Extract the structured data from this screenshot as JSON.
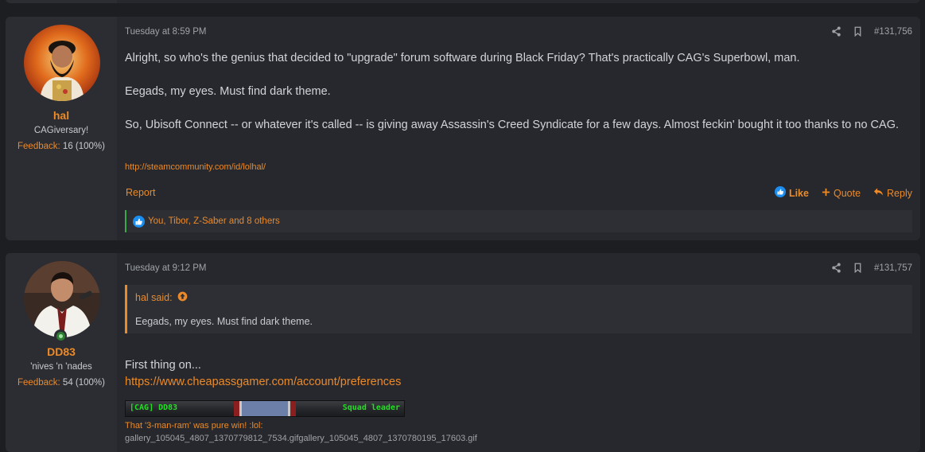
{
  "posts": [
    {
      "username": "hal",
      "user_title": "CAGiversary!",
      "feedback_label": "Feedback:",
      "feedback_value": "16 (100%)",
      "timestamp": "Tuesday at 8:59 PM",
      "post_number": "#131,756",
      "paragraphs": [
        "Alright, so who's the genius that decided to \"upgrade\" forum software during Black Friday? That's practically CAG's Superbowl, man.",
        "Eegads, my eyes. Must find dark theme.",
        "So, Ubisoft Connect -- or whatever it's called -- is giving away Assassin's Creed Syndicate for a few days. Almost feckin' bought it too thanks to no CAG."
      ],
      "signature_link": "http://steamcommunity.com/id/lolhal/",
      "report_label": "Report",
      "like_label": "Like",
      "quote_label": "Quote",
      "reply_label": "Reply",
      "reactions_text": "You, Tibor, Z-Saber and 8 others"
    },
    {
      "username": "DD83",
      "user_title": "'nives 'n 'nades",
      "feedback_label": "Feedback:",
      "feedback_value": "54 (100%)",
      "timestamp": "Tuesday at 9:12 PM",
      "post_number": "#131,757",
      "quote_author": "hal said:",
      "quote_text": "Eegads, my eyes. Must find dark theme.",
      "body_line": "First thing on...",
      "body_link": "https://www.cheapassgamer.com/account/preferences",
      "banner_left": "[CAG] DD83",
      "banner_right": "Squad leader",
      "sig_line1": "That '3-man-ram' was pure win! :lol:",
      "sig_line2": "gallery_105045_4807_1370779812_7534.gifgallery_105045_4807_1370780195_17603.gif"
    }
  ],
  "colors": {
    "accent": "#ec8a28",
    "page_bg": "#1d1e22",
    "post_bg": "#26282d",
    "like_blue": "#1b8ef0",
    "online_green": "#2e7d32"
  },
  "icons": [
    "share-icon",
    "bookmark-icon",
    "thumbs-up-icon",
    "plus-icon",
    "reply-arrow-icon",
    "up-arrow-circle-icon",
    "online-status-icon"
  ]
}
